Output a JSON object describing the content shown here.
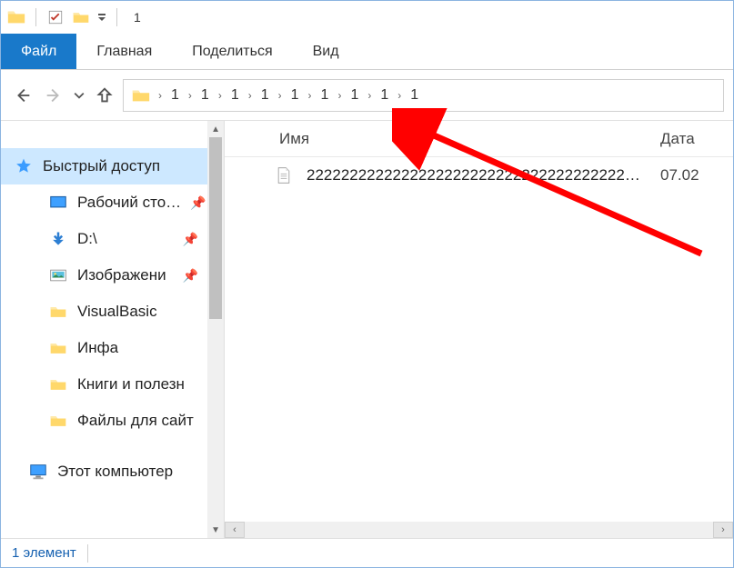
{
  "titlebar": {
    "title": "1"
  },
  "ribbon": {
    "tabs": [
      {
        "label": "Файл",
        "active": true
      },
      {
        "label": "Главная",
        "active": false
      },
      {
        "label": "Поделиться",
        "active": false
      },
      {
        "label": "Вид",
        "active": false
      }
    ]
  },
  "breadcrumb": {
    "segments": [
      "1",
      "1",
      "1",
      "1",
      "1",
      "1",
      "1",
      "1",
      "1"
    ]
  },
  "sidebar": {
    "quick_access": {
      "label": "Быстрый доступ",
      "selected": true,
      "icon": "star"
    },
    "items": [
      {
        "label": "Рабочий сто…",
        "icon": "desktop",
        "pinned": true
      },
      {
        "label": "D:\\",
        "icon": "download-arrow",
        "pinned": true
      },
      {
        "label": "Изображени",
        "icon": "pictures",
        "pinned": true
      },
      {
        "label": "VisualBasic",
        "icon": "folder",
        "pinned": false
      },
      {
        "label": "Инфа",
        "icon": "folder",
        "pinned": false
      },
      {
        "label": "Книги и полезн",
        "icon": "folder",
        "pinned": false
      },
      {
        "label": "Файлы для сайт",
        "icon": "folder",
        "pinned": false
      }
    ],
    "this_pc": {
      "label": "Этот компьютер",
      "icon": "this-pc"
    }
  },
  "content": {
    "columns": {
      "name": "Имя",
      "date": "Дата"
    },
    "files": [
      {
        "name": "2222222222222222222222222222222222222…",
        "date": "07.02",
        "icon": "text-file"
      }
    ]
  },
  "status": {
    "text": "1 элемент"
  }
}
